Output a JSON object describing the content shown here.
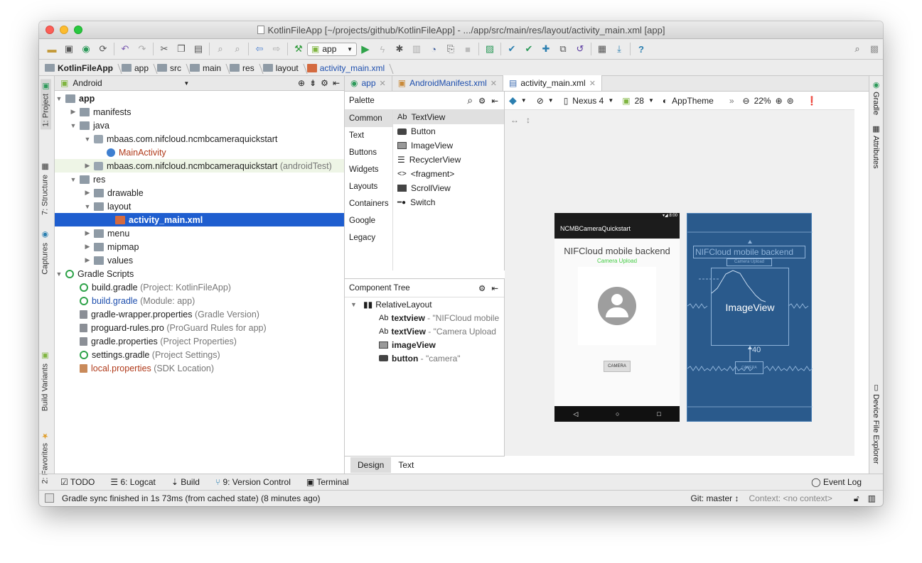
{
  "window": {
    "title": "KotlinFileApp [~/projects/github/KotlinFileApp] - .../app/src/main/res/layout/activity_main.xml [app]"
  },
  "toolbar": {
    "run_config": "app"
  },
  "breadcrumbs": [
    "KotlinFileApp",
    "app",
    "src",
    "main",
    "res",
    "layout",
    "activity_main.xml"
  ],
  "left_tabs": [
    "1: Project",
    "7: Structure",
    "Captures",
    "Build Variants",
    "2: Favorites"
  ],
  "right_tabs": [
    "Gradle",
    "Attributes",
    "Device File Explorer"
  ],
  "project": {
    "view": "Android",
    "tree": [
      {
        "label": "app",
        "bold": true
      },
      {
        "label": "manifests"
      },
      {
        "label": "java"
      },
      {
        "label": "mbaas.com.nifcloud.ncmbcameraquickstart"
      },
      {
        "label": "MainActivity"
      },
      {
        "label": "mbaas.com.nifcloud.ncmbcameraquickstart",
        "suffix": "(androidTest)"
      },
      {
        "label": "res"
      },
      {
        "label": "drawable"
      },
      {
        "label": "layout"
      },
      {
        "label": "activity_main.xml"
      },
      {
        "label": "menu"
      },
      {
        "label": "mipmap"
      },
      {
        "label": "values"
      },
      {
        "label": "Gradle Scripts"
      },
      {
        "label": "build.gradle",
        "suffix": "(Project: KotlinFileApp)"
      },
      {
        "label": "build.gradle",
        "suffix": "(Module: app)"
      },
      {
        "label": "gradle-wrapper.properties",
        "suffix": "(Gradle Version)"
      },
      {
        "label": "proguard-rules.pro",
        "suffix": "(ProGuard Rules for app)"
      },
      {
        "label": "gradle.properties",
        "suffix": "(Project Properties)"
      },
      {
        "label": "settings.gradle",
        "suffix": "(Project Settings)"
      },
      {
        "label": "local.properties",
        "suffix": "(SDK Location)"
      }
    ]
  },
  "editor_tabs": [
    "app",
    "AndroidManifest.xml",
    "activity_main.xml"
  ],
  "palette": {
    "title": "Palette",
    "categories": [
      "Common",
      "Text",
      "Buttons",
      "Widgets",
      "Layouts",
      "Containers",
      "Google",
      "Legacy"
    ],
    "items": [
      "TextView",
      "Button",
      "ImageView",
      "RecyclerView",
      "<fragment>",
      "ScrollView",
      "Switch"
    ]
  },
  "component_tree": {
    "title": "Component Tree",
    "root": "RelativeLayout",
    "children": [
      {
        "name": "textview",
        "detail": "- \"NIFCloud mobile"
      },
      {
        "name": "textView",
        "detail": "- \"Camera Upload"
      },
      {
        "name": "imageView",
        "detail": ""
      },
      {
        "name": "button",
        "detail": "- \"camera\""
      }
    ]
  },
  "design": {
    "device": "Nexus 4",
    "api": "28",
    "theme": "AppTheme",
    "zoom": "22%"
  },
  "phone": {
    "app_title": "NCMBCameraQuickstart",
    "heading": "NIFCloud mobile backend",
    "subheading": "Camera Upload",
    "button": "CAMERA",
    "status_time": "8:00"
  },
  "blueprint": {
    "heading": "NIFCloud mobile backend",
    "sub": "Camera Upload",
    "image": "ImageView",
    "margin": "40",
    "button": "CAMERA"
  },
  "bottom_editor_tabs": [
    "Design",
    "Text"
  ],
  "tool_windows": [
    "TODO",
    "6: Logcat",
    "Build",
    "9: Version Control",
    "Terminal"
  ],
  "event_log": "Event Log",
  "status": {
    "message": "Gradle sync finished in 1s 73ms (from cached state) (8 minutes ago)",
    "git": "Git: master ↕",
    "context": "Context: <no context>"
  }
}
